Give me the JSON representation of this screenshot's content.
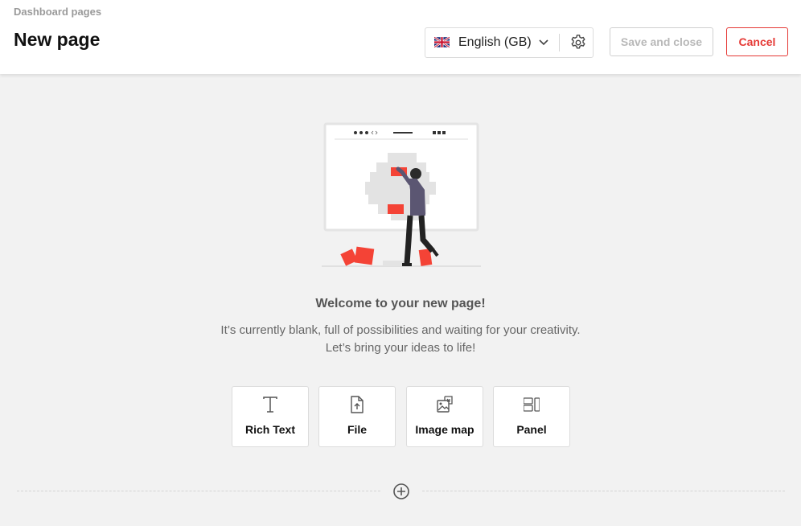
{
  "header": {
    "breadcrumb": "Dashboard pages",
    "title": "New page",
    "language": {
      "flag_icon": "uk-flag-icon",
      "label": "English (GB)",
      "dropdown_icon": "chevron-down-icon"
    },
    "settings_icon": "gear-icon",
    "save_label": "Save and close",
    "cancel_label": "Cancel"
  },
  "empty_state": {
    "illustration": "person-building-page-illustration",
    "title": "Welcome to your new page!",
    "line1": "It’s currently blank, full of possibilities and waiting for your creativity.",
    "line2": "Let’s bring your ideas to life!"
  },
  "blocks": [
    {
      "label": "Rich Text",
      "icon": "text-icon"
    },
    {
      "label": "File",
      "icon": "file-upload-icon"
    },
    {
      "label": "Image map",
      "icon": "image-map-icon"
    },
    {
      "label": "Panel",
      "icon": "panel-icon"
    }
  ],
  "add_section_icon": "plus-circle-icon",
  "colors": {
    "accent": "#e53935",
    "illustration_red": "#f44336",
    "background": "#f2f2f2"
  }
}
